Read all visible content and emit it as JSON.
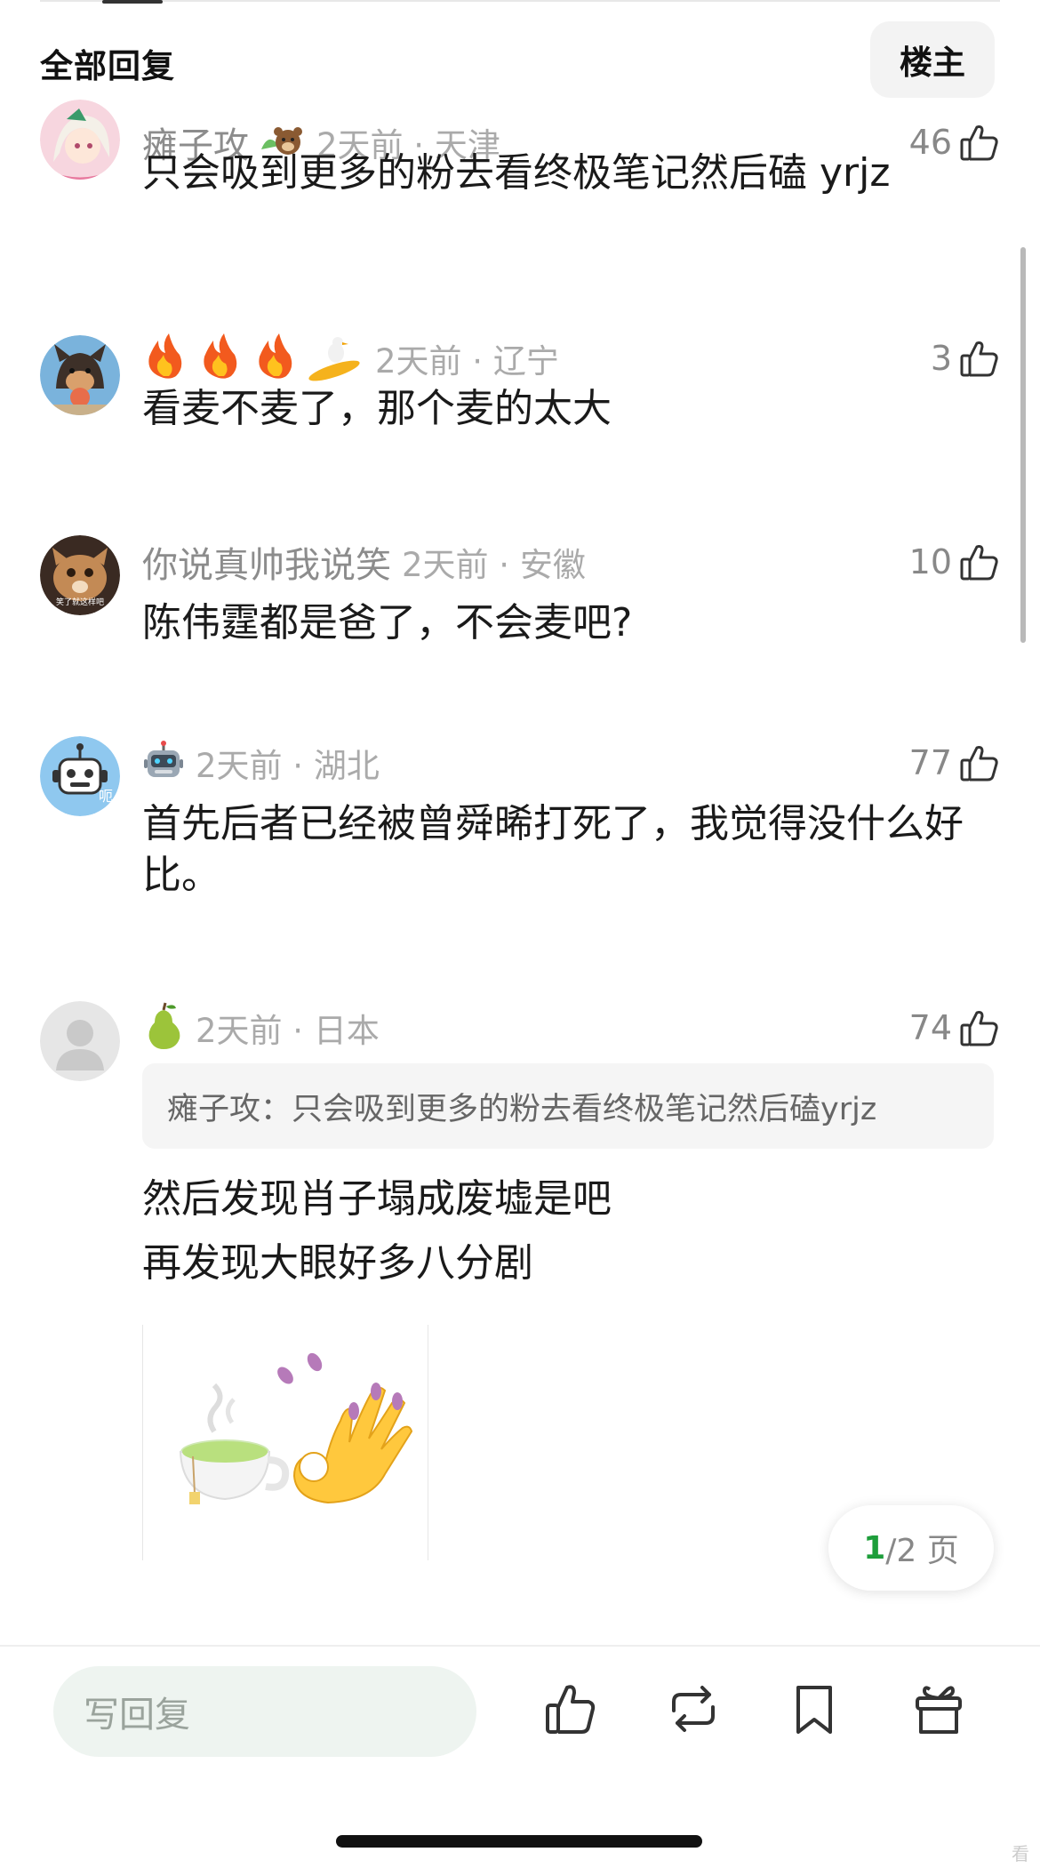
{
  "header": {
    "title": "全部回复",
    "op_button": "楼主"
  },
  "comments": [
    {
      "user": "瘫子攻",
      "badge": "bear-emoji",
      "time": "2天前 · 天津",
      "likes": "46",
      "text": "只会吸到更多的粉去看终极笔记然后磕 yrjz"
    },
    {
      "user": "",
      "badge": "fire-fire-fire-surf-emoji",
      "time": "2天前 · 辽宁",
      "likes": "3",
      "text": "看麦不麦了，那个麦的太大"
    },
    {
      "user": "你说真帅我说笑",
      "badge": "",
      "time": "2天前 · 安徽",
      "likes": "10",
      "text": "陈伟霆都是爸了，不会麦吧?",
      "avatar_caption": "笑了就这样吧"
    },
    {
      "user": "",
      "badge": "robot-emoji",
      "time": "2天前 · 湖北",
      "likes": "77",
      "text": "首先后者已经被曾舜晞打死了，我觉得没什么好比。",
      "avatar_caption": "呃"
    },
    {
      "user": "",
      "badge": "pear-emoji",
      "time": "2天前 · 日本",
      "likes": "74",
      "quote": "瘫子攻：只会吸到更多的粉去看终极笔记然后磕yrjz",
      "text_lines": [
        "然后发现肖子塌成废墟是吧",
        "再发现大眼好多八分剧"
      ],
      "image": "tea-cup-ok-hand-sticker"
    }
  ],
  "pager": {
    "current": "1",
    "rest": "/2 页"
  },
  "bottom_bar": {
    "reply_placeholder": "写回复",
    "icons": [
      "thumbs-up-icon",
      "repost-icon",
      "bookmark-icon",
      "gift-icon"
    ]
  },
  "corner_mark": "看",
  "colors": {
    "accent": "#1e9e3b",
    "muted": "#8c8c8c",
    "input_bg": "#eef4f0"
  }
}
